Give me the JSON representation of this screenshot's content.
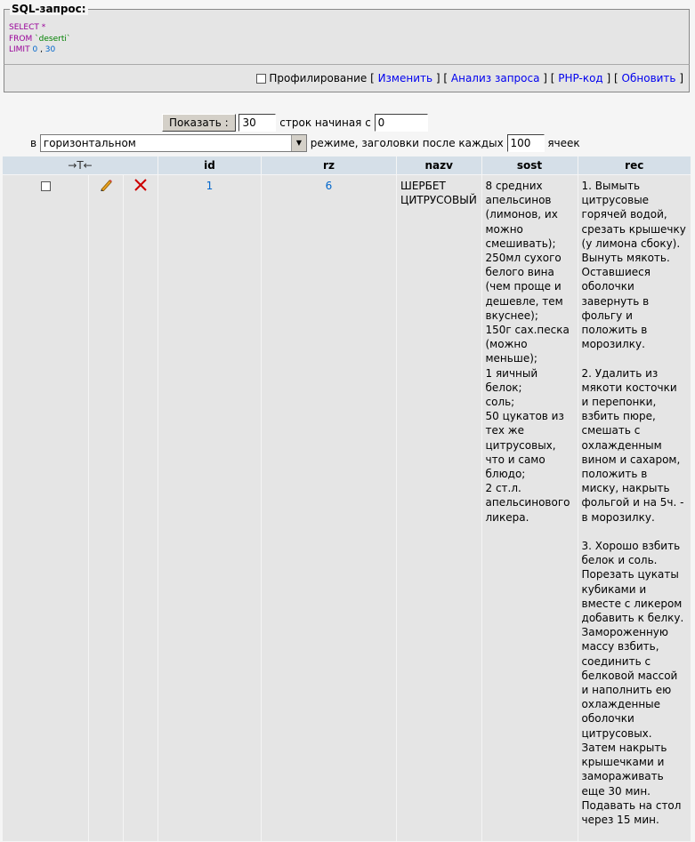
{
  "sql": {
    "legend": "SQL-запрос:",
    "select": "SELECT",
    "star": " *",
    "from": "FROM",
    "table": " `deserti`",
    "limit": "LIMIT",
    "offset": "0",
    "sep": " , ",
    "count": "30"
  },
  "profiling": {
    "label": "Профилирование",
    "lb1": " [ ",
    "edit": "Изменить",
    "rb1": " ] ",
    "lb2": "[ ",
    "explain": "Анализ запроса",
    "rb2": " ] ",
    "lb3": "[ ",
    "php": "PHP-код",
    "rb3": " ] ",
    "lb4": "[ ",
    "refresh": "Обновить",
    "rb4": " ]"
  },
  "nav": {
    "show_button": "Показать :",
    "rows_value": "30",
    "rows_text": "строк начиная с",
    "start_value": "0",
    "in_text": "в",
    "mode_value": "горизонтальном",
    "mode_text": "режиме, заголовки после каждых",
    "repeat_value": "100",
    "cells_text": "ячеек"
  },
  "table": {
    "arrows_header": "→T←",
    "columns": [
      "id",
      "rz",
      "nazv",
      "sost",
      "rec"
    ],
    "row": {
      "id": "1",
      "rz": "6",
      "nazv": "ШЕРБЕТ ЦИТРУСОВЫЙ",
      "sost": "8 средних апельсинов (лимонов, их можно смешивать);\n250мл сухого белого вина (чем проще и дешевле, тем вкуснее);\n150г сах.песка (можно меньше);\n1 яичный белок;\nсоль;\n50 цукатов из тех же цитрусовых, что и само блюдо;\n2 ст.л. апельсинового ликера.",
      "rec_p1": "1. Вымыть цитрусовые горячей водой, срезать крышечку (у лимона сбоку). Вынуть мякоть. Оставшиеся оболочки завернуть в фольгу и положить в морозилку.",
      "rec_p2": "2. Удалить из мякоти косточки и перепонки, взбить пюре, смешать с охлажденным вином и сахаром, положить в миску, накрыть фольгой и на 5ч. - в морозилку.",
      "rec_p3": "3. Хорошо взбить белок и соль. Порезать цукаты кубиками и вместе с ликером добавить к белку. Замороженную массу взбить, соединить с белковой массой и наполнить ею охлажденные оболочки цитрусовых. Затем накрыть крышечками и замораживать еще 30 мин.\nПодавать на стол через 15 мин."
    }
  },
  "colors": {
    "header_bg": "#d5dfe8",
    "row_bg": "#e5e5e5",
    "link": "#0000ee",
    "delete_icon": "#cc0000",
    "keyword": "#990099"
  }
}
